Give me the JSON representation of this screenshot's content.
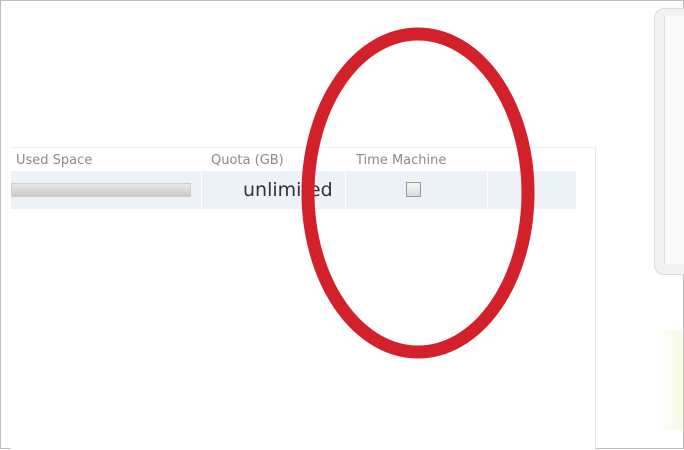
{
  "table": {
    "columns": {
      "used_space": "Used Space",
      "quota": "Quota (GB)",
      "time_machine": "Time Machine"
    },
    "rows": [
      {
        "used_space_fraction": 1.0,
        "quota": "unlimited",
        "time_machine_checked": false
      }
    ]
  },
  "annotation": {
    "shape": "ellipse",
    "color": "#d3212c",
    "target": "time-machine-column"
  }
}
